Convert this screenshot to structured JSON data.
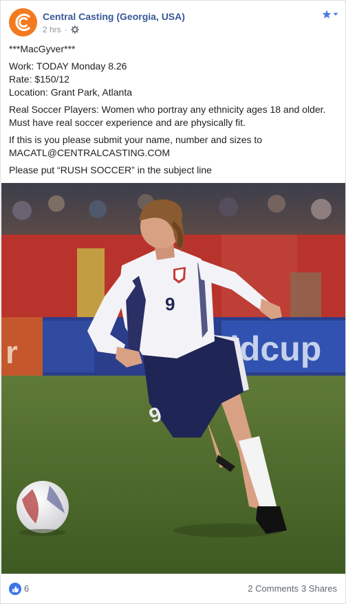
{
  "post": {
    "page_name": "Central Casting (Georgia, USA)",
    "time": "2 hrs",
    "separator": "·",
    "audience_icon": "gear-icon",
    "menu_icon": "star-dropdown-icon"
  },
  "content": {
    "title": "***MacGyver***",
    "work": "Work: TODAY Monday 8.26",
    "rate": "Rate: $150/12",
    "location": "Location: Grant Park, Atlanta",
    "description_line1": "Real Soccer Players: Women who portray any ethnicity ages 18 and older.",
    "description_line2": "Must have real soccer experience and are physically fit.",
    "submit_line1": "If this is you please submit your name, number and sizes to",
    "submit_line2": "MACATL@CENTRALCASTING.COM",
    "subject_line": "Please put “RUSH SOCCER” in the subject line"
  },
  "photo": {
    "jersey_number": "9",
    "banner_text": "ldcup",
    "banner_text_left": "r"
  },
  "footer": {
    "like_count": "6",
    "comments": "2 Comments",
    "shares": "3 Shares"
  },
  "colors": {
    "brand_orange": "#f47a20",
    "link_blue": "#385898",
    "like_blue": "#3b76e8",
    "meta_gray": "#90949c"
  }
}
